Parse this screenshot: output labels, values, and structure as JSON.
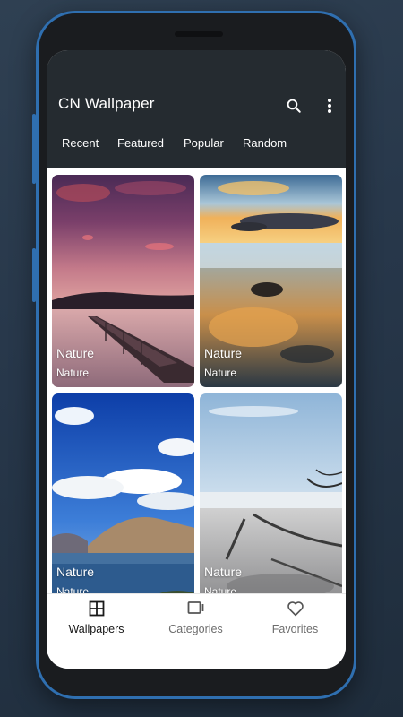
{
  "app": {
    "title": "CN Wallpaper"
  },
  "appbar_icons": [
    "search-icon",
    "more-vert-icon"
  ],
  "tabs": [
    {
      "label": "Recent"
    },
    {
      "label": "Featured"
    },
    {
      "label": "Popular"
    },
    {
      "label": "Random"
    }
  ],
  "wallpapers": [
    {
      "title": "Nature",
      "category": "Nature"
    },
    {
      "title": "Nature",
      "category": "Nature"
    },
    {
      "title": "Nature",
      "category": "Nature"
    },
    {
      "title": "Nature",
      "category": "Nature"
    }
  ],
  "bottom_nav": [
    {
      "label": "Wallpapers",
      "icon": "grid-icon",
      "active": true
    },
    {
      "label": "Categories",
      "icon": "categories-icon",
      "active": false
    },
    {
      "label": "Favorites",
      "icon": "heart-icon",
      "active": false
    }
  ],
  "colors": {
    "appbar": "#252b30",
    "phone_frame": "#2f6fb0",
    "background": "#2b3b4d"
  }
}
